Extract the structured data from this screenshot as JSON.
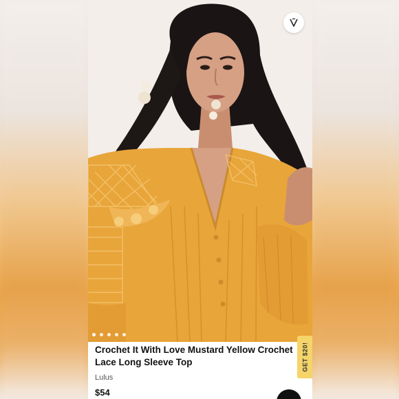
{
  "listing": {
    "title": "Crochet It With Love Mustard Yellow Crochet Lace Long Sleeve Top",
    "brand": "Lulus",
    "price": "$54",
    "promo_label": "GET $20!",
    "image": {
      "icon": "model-photo",
      "carousel_count": 5,
      "carousel_active": 1
    },
    "favorite_icon": "heart-icon"
  },
  "colors": {
    "garment": "#e8a53a",
    "promo": "#f5d46a",
    "text": "#111111"
  }
}
